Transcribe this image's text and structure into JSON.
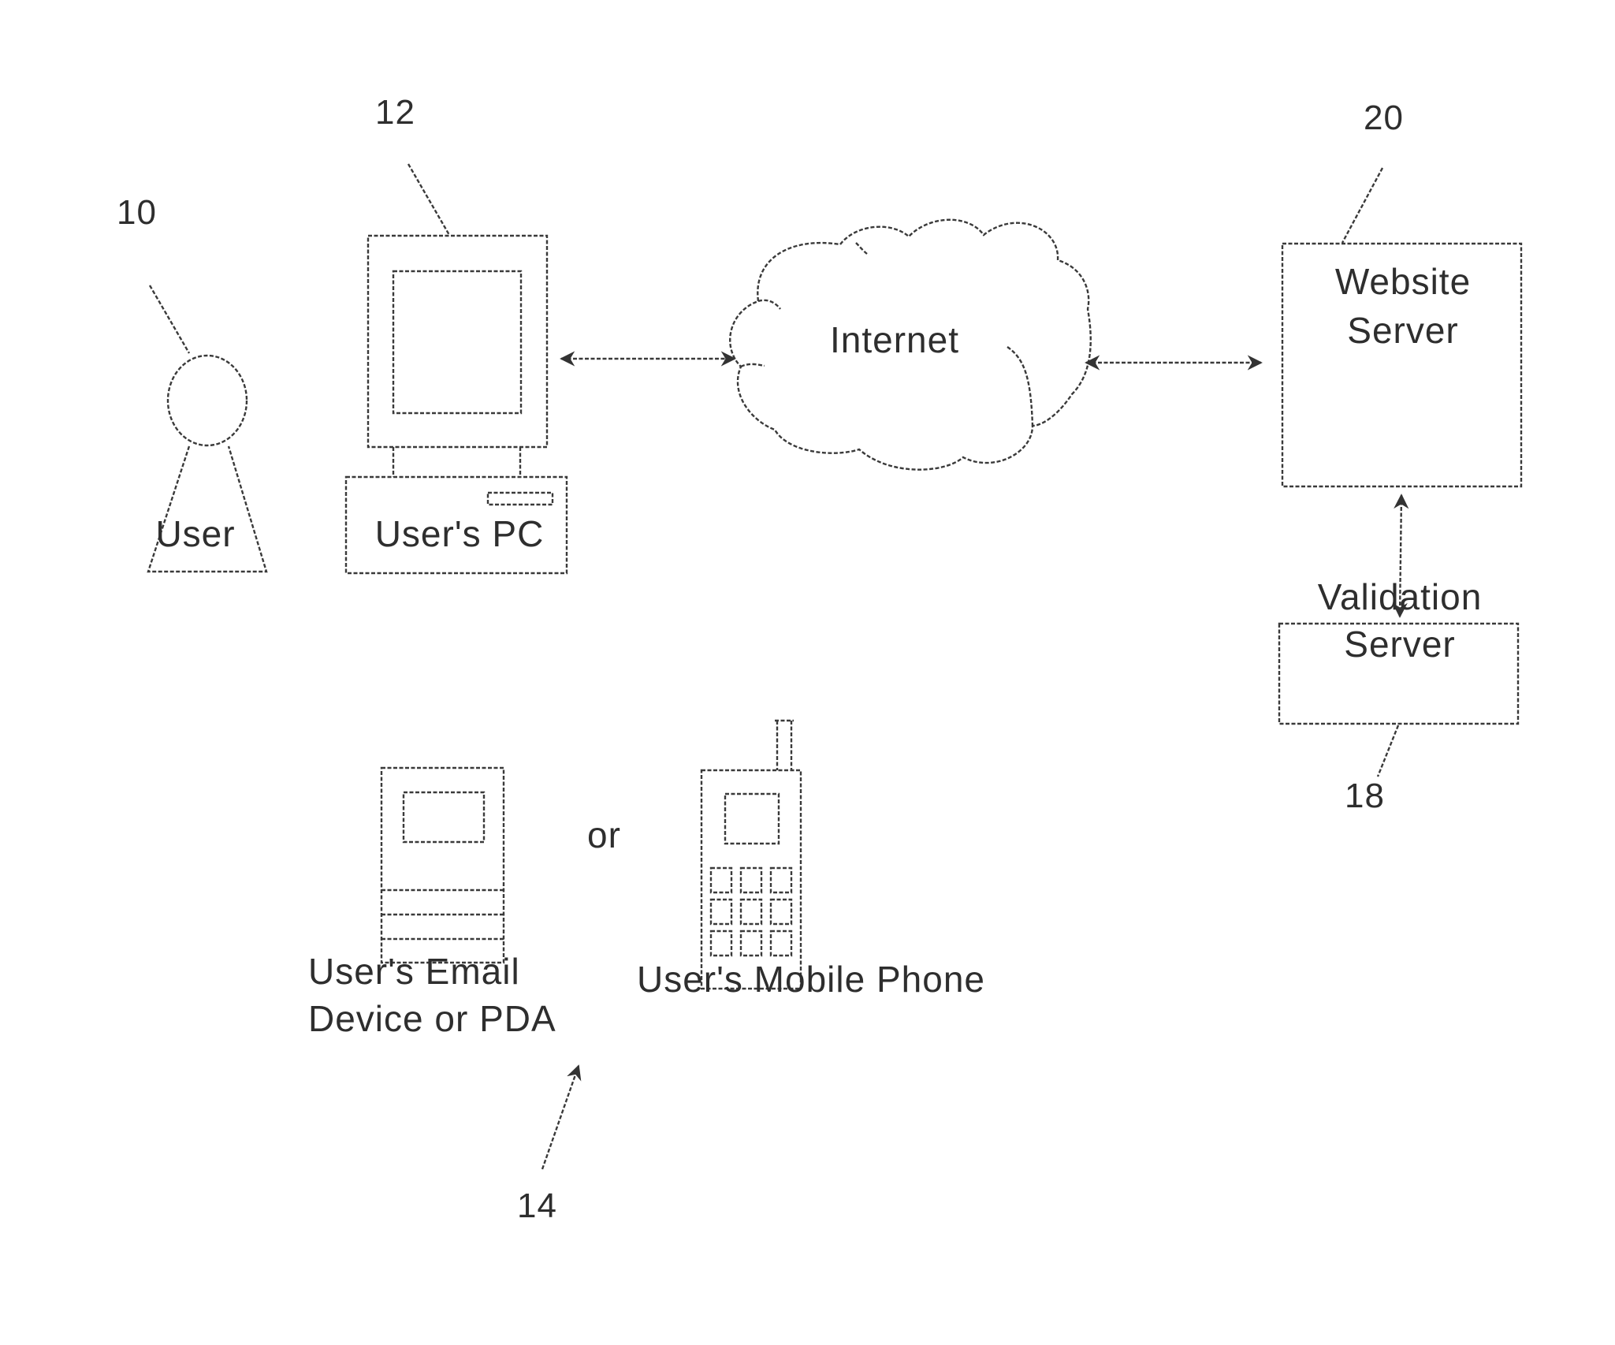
{
  "diagram": {
    "nodes": {
      "user": {
        "label": "User",
        "ref": "10"
      },
      "pc": {
        "label": "User's PC",
        "ref": "12"
      },
      "internet": {
        "label": "Internet"
      },
      "website_server": {
        "line1": "Website",
        "line2": "Server",
        "ref": "20"
      },
      "validation_server": {
        "line1": "Validation",
        "line2": "Server",
        "ref": "18"
      },
      "email_device": {
        "line1": "User's Email",
        "line2": "Device or PDA"
      },
      "mobile_phone": {
        "label": "User's Mobile Phone"
      },
      "device_group": {
        "ref": "14",
        "separator": "or"
      }
    },
    "edges": [
      {
        "from": "pc",
        "to": "internet",
        "type": "bidirectional"
      },
      {
        "from": "internet",
        "to": "website_server",
        "type": "bidirectional"
      },
      {
        "from": "website_server",
        "to": "validation_server",
        "type": "bidirectional"
      }
    ],
    "line_color": "#3a3a3a"
  }
}
